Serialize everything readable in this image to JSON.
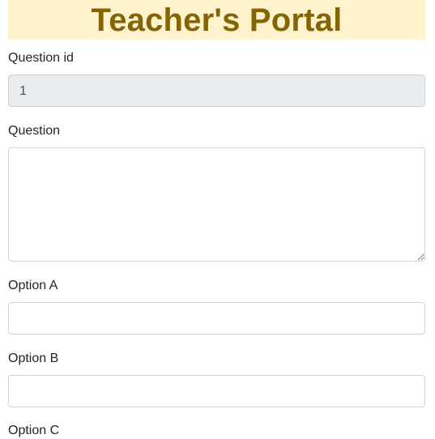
{
  "header": {
    "title": "Teacher's Portal"
  },
  "form": {
    "question_id": {
      "label": "Question id",
      "value": "1"
    },
    "question": {
      "label": "Question",
      "value": ""
    },
    "option_a": {
      "label": "Option A",
      "value": ""
    },
    "option_b": {
      "label": "Option B",
      "value": ""
    },
    "option_c": {
      "label": "Option C"
    }
  },
  "colors": {
    "banner_bg": "#fff3cd",
    "banner_text": "#856404",
    "readonly_bg": "#e9ecef",
    "border": "#ced4da"
  }
}
